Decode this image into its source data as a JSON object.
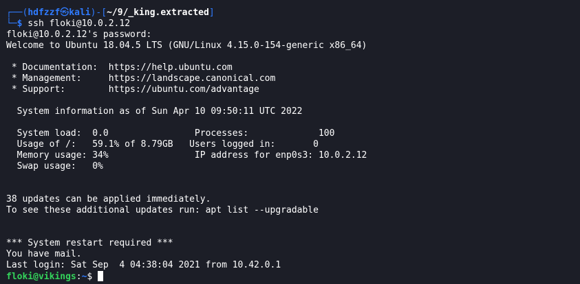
{
  "prompt": {
    "corner_top": "┌──(",
    "user": "hdfzzf",
    "at": "㉿",
    "host": "kali",
    "close_paren": ")-[",
    "path": "~/9/_king.extracted",
    "close_bracket": "]",
    "corner_bottom": "└─",
    "symbol": "$",
    "command": " ssh floki@10.0.2.12"
  },
  "output": [
    "floki@10.0.2.12's password:",
    "Welcome to Ubuntu 18.04.5 LTS (GNU/Linux 4.15.0-154-generic x86_64)",
    "",
    " * Documentation:  https://help.ubuntu.com",
    " * Management:     https://landscape.canonical.com",
    " * Support:        https://ubuntu.com/advantage",
    "",
    "  System information as of Sun Apr 10 09:50:11 UTC 2022",
    "",
    "  System load:  0.0                Processes:             100",
    "  Usage of /:   59.1% of 8.79GB   Users logged in:       0",
    "  Memory usage: 34%                IP address for enp0s3: 10.0.2.12",
    "  Swap usage:   0%",
    "",
    "",
    "38 updates can be applied immediately.",
    "To see these additional updates run: apt list --upgradable",
    "",
    "",
    "*** System restart required ***",
    "You have mail.",
    "Last login: Sat Sep  4 04:38:04 2021 from 10.42.0.1"
  ],
  "remote_prompt": {
    "user_host": "floki@vikings",
    "sep": ":",
    "path": "~",
    "symbol": "$ "
  }
}
